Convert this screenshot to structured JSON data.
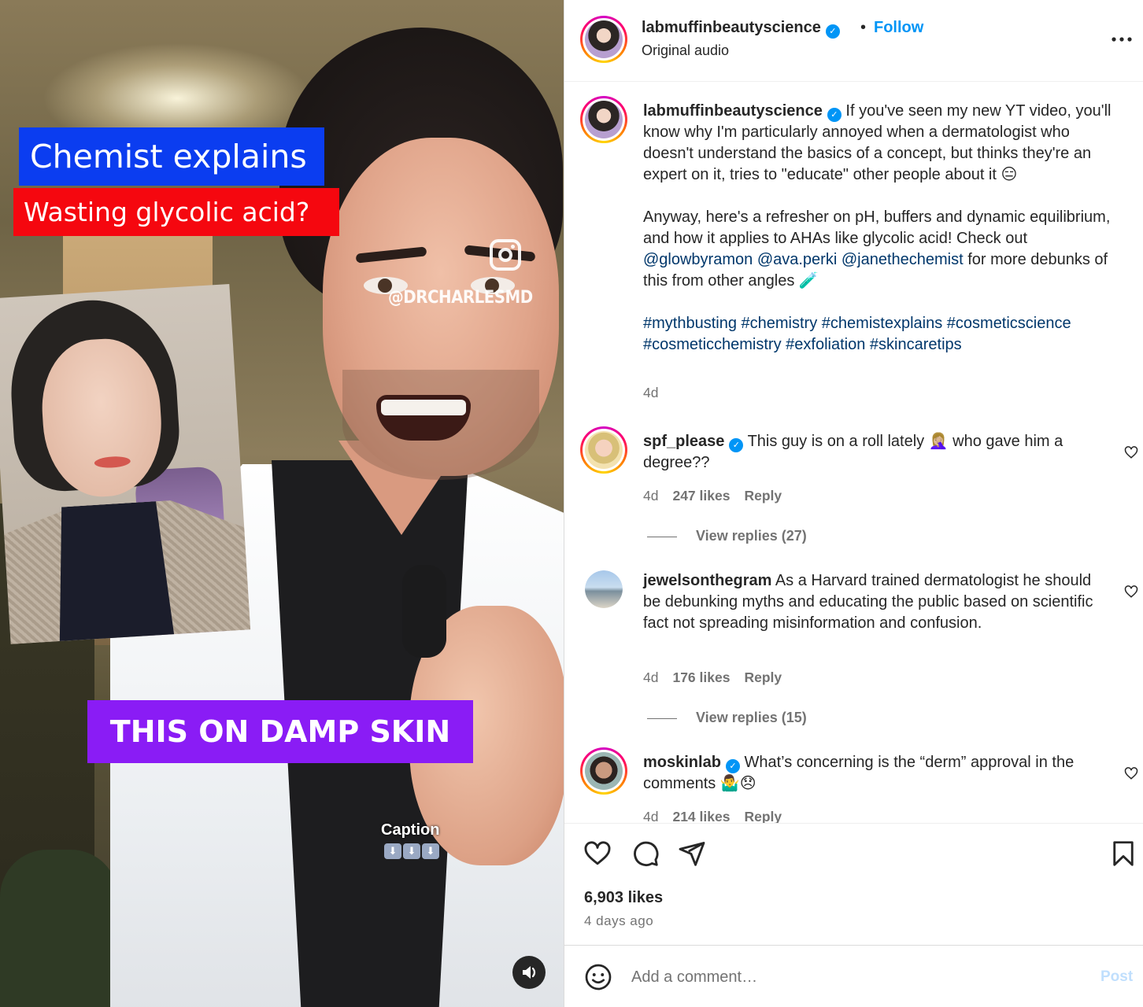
{
  "video": {
    "title_line_1": "Chemist explains",
    "title_line_2": "Wasting glycolic acid?",
    "watermark": "@DRCHARLESMD",
    "overlay_caption": "THIS ON DAMP SKIN",
    "caption_label": "Caption",
    "caption_arrows": [
      "⬇",
      "⬇",
      "⬇"
    ]
  },
  "header": {
    "username": "labmuffinbeautyscience",
    "separator": "•",
    "follow_label": "Follow",
    "subtitle": "Original audio",
    "more_icon": "more-horizontal-icon"
  },
  "post_caption": {
    "username": "labmuffinbeautyscience",
    "text_1": "If you've seen my new YT video, you'll know why I'm particularly annoyed when a dermatologist who doesn't understand the basics of a concept, but thinks they're an expert on it, tries to \"educate\" other people about it",
    "emoji_1": "😑",
    "text_2": "Anyway, here's a refresher on pH, buffers and dynamic equilibrium, and how it applies to AHAs like glycolic acid! Check out",
    "mention_1": "@glowbyramon",
    "mention_2": "@ava.perki",
    "mention_3": "@janethechemist",
    "text_3": "for more debunks of this from other angles",
    "emoji_2": "🧪",
    "hashtags": [
      "#mythbusting",
      "#chemistry",
      "#chemistexplains",
      "#cosmeticscience",
      "#cosmeticchemistry",
      "#exfoliation",
      "#skincaretips"
    ],
    "time": "4d"
  },
  "comments": [
    {
      "username": "spf_please",
      "verified": true,
      "text": "This guy is on a roll lately 🤦🏼‍♀️ who gave him a degree??",
      "time": "4d",
      "likes": "247 likes",
      "reply_label": "Reply",
      "view_replies": "View replies (27)"
    },
    {
      "username": "jewelsonthegram",
      "verified": false,
      "text": "As a Harvard trained dermatologist he should be debunking myths and educating the public based on scientific fact not spreading misinformation and confusion.",
      "time": "4d",
      "likes": "176 likes",
      "reply_label": "Reply",
      "view_replies": "View replies (15)"
    },
    {
      "username": "moskinlab",
      "verified": true,
      "text": "What’s concerning is the “derm” approval in the comments 🤷‍♂️😞",
      "time": "4d",
      "likes": "214 likes",
      "reply_label": "Reply"
    }
  ],
  "actions": {
    "likes": "6,903 likes",
    "date": "4 days ago",
    "icons": [
      "heart-icon",
      "comment-icon",
      "share-icon",
      "bookmark-icon"
    ]
  },
  "composer": {
    "placeholder": "Add a comment…",
    "post_label": "Post"
  },
  "colors": {
    "follow_blue": "#0095f6",
    "link_blue": "#00376b",
    "title_blue_bg": "#0b3df0",
    "title_red_bg": "#f5070f",
    "caption_purple_bg": "#8a1cf5",
    "post_disabled": "#c0dffd"
  }
}
